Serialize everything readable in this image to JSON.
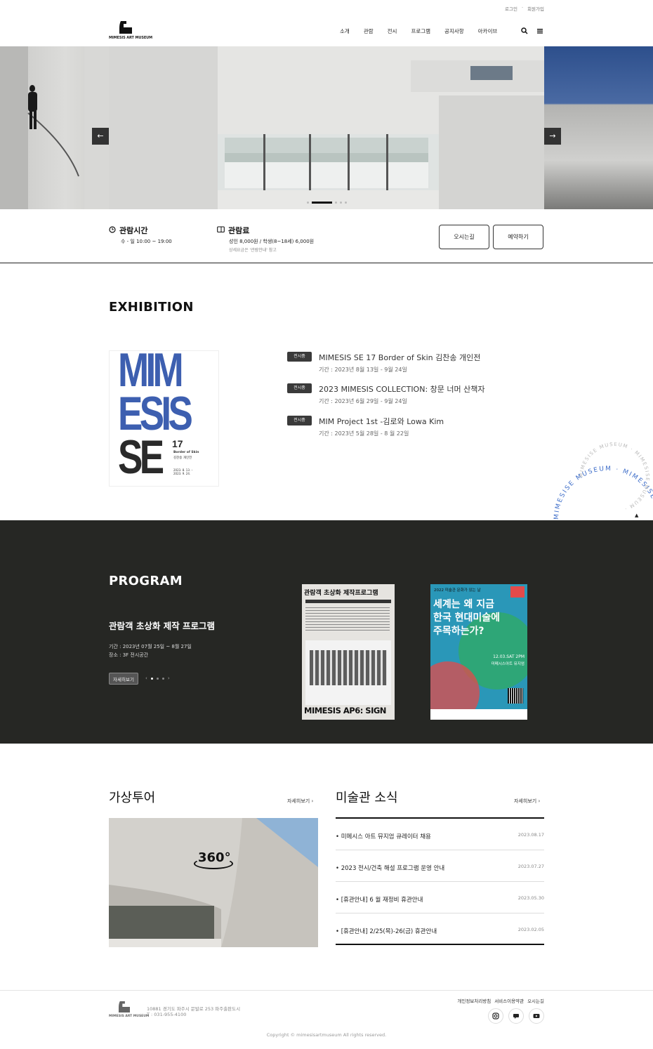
{
  "topbar": {
    "login": "로그인",
    "signup": "회원가입"
  },
  "header": {
    "logo_text": "MIMESIS ART MUSEUM",
    "nav": [
      "소개",
      "관람",
      "전시",
      "프로그램",
      "공지사항",
      "아카이브"
    ]
  },
  "info": {
    "hours_title": "관람시간",
    "hours_value": "수 - 일 10:00 ~ 19:00",
    "fee_title": "관람료",
    "fee_value": "성인 8,000원 / 학생(8~18세) 6,000원",
    "fee_note": "상세요금은 '관람안내' 참고",
    "directions_label": "오시는길",
    "booking_label": "예약하기"
  },
  "exhibition": {
    "title": "EXHIBITION",
    "poster": {
      "line1": "MIM",
      "line2": "ESIS",
      "line3": "SE",
      "num": "17",
      "sub1": "Border of Skin",
      "sub2": "김찬송 개인전",
      "dates": "2023. 8. 13. – 2023. 9. 24."
    },
    "items": [
      {
        "badge": "전시중",
        "title": "MIMESIS SE 17 Border of Skin 김찬송 개인전",
        "date": "기간 : 2023년 8월 13일 - 9월 24일"
      },
      {
        "badge": "전시중",
        "title": "2023 MIMESIS COLLECTION: 창문 너머 산책자",
        "date": "기간 : 2023년 6월 29일 - 9월 24일"
      },
      {
        "badge": "전시중",
        "title": "MIM Project 1st -김로와 Lowa Kim",
        "date": "기간 : 2023년 5월 28일 - 8 월 22일"
      }
    ],
    "circle_text": "MIMESISE MUSEUM · MIMESISE MUSEUM · "
  },
  "program": {
    "title": "PROGRAM",
    "name": "관람객 초상화 제작 프로그램",
    "period": "기간 : 2023년 07월 25일 ~ 8월 27일",
    "place": "장소 : 3F 전시공간",
    "more": "자세히보기",
    "poster1": {
      "head": "관람객 초상화 제작프로그램",
      "foot": "MIMESIS AP6: SIGN"
    },
    "poster2": {
      "top": "2022 미술관 문화가 있는 날",
      "line1": "세계는 왜 지금",
      "line2": "한국 현대미술에",
      "line3": "주목하는가?",
      "date": "12.03.SAT 2PM",
      "place": "미메시스아트 뮤지엄"
    }
  },
  "tour": {
    "title": "가상투어",
    "more": "자세히보기",
    "badge": "360°"
  },
  "news": {
    "title": "미술관 소식",
    "more": "자세히보기",
    "items": [
      {
        "title": "미메시스 아트 뮤지엄 큐레이터 채용",
        "date": "2023.08.17"
      },
      {
        "title": "2023 전시/건축 해설 프로그램 운영 안내",
        "date": "2023.07.27"
      },
      {
        "title": "[휴관안내] 6 월 재정비 휴관안내",
        "date": "2023.05.30"
      },
      {
        "title": "[휴관안내] 2/25(목)-26(금) 휴관안내",
        "date": "2023.02.05"
      }
    ]
  },
  "footer": {
    "address": "10881 경기도 파주시 문발로 253 파주출판도시",
    "phone": "T : 031-955-4100",
    "links": [
      "개인정보처리방침",
      "서비스이용약관",
      "오시는길"
    ],
    "copyright": "Copyright © mimesisartmuseum All rights reserved."
  }
}
